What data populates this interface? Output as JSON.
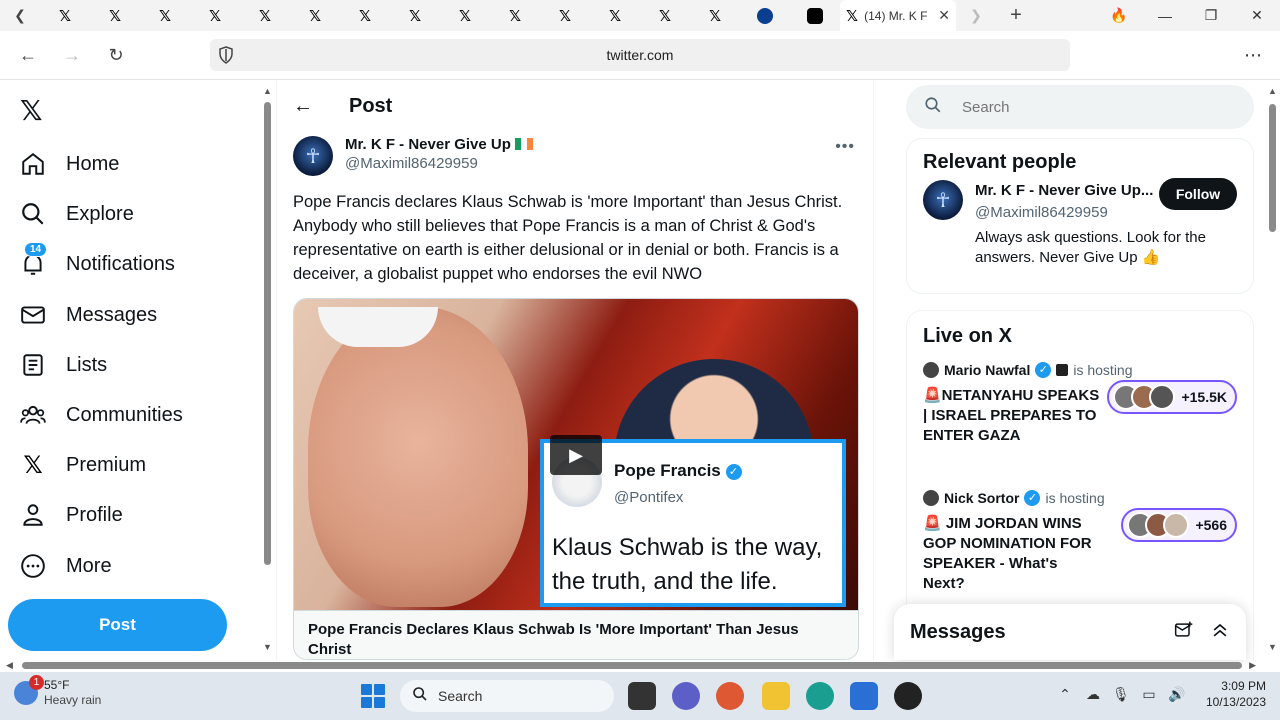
{
  "browser": {
    "active_tab_title": "(14) Mr. K F",
    "url": "twitter.com"
  },
  "nav": {
    "items": [
      {
        "label": "Home",
        "icon": "home-icon"
      },
      {
        "label": "Explore",
        "icon": "search-icon"
      },
      {
        "label": "Notifications",
        "icon": "bell-icon",
        "badge": "14"
      },
      {
        "label": "Messages",
        "icon": "envelope-icon"
      },
      {
        "label": "Lists",
        "icon": "list-icon"
      },
      {
        "label": "Communities",
        "icon": "people-icon"
      },
      {
        "label": "Premium",
        "icon": "x-logo-icon"
      },
      {
        "label": "Profile",
        "icon": "person-icon"
      },
      {
        "label": "More",
        "icon": "more-circle-icon"
      }
    ],
    "post_button": "Post"
  },
  "main": {
    "header_title": "Post",
    "author": {
      "name": "Mr. K F - Never Give Up",
      "handle": "@Maximil86429959"
    },
    "text": "Pope Francis declares Klaus Schwab is 'more Important' than Jesus Christ. Anybody who still believes that Pope Francis is a man of Christ & God's representative on earth is either delusional or in denial or both. Francis is a deceiver, a globalist puppet who endorses the evil NWO",
    "media": {
      "quote_name": "Pope Francis",
      "quote_handle": "@Pontifex",
      "quote_text": "Klaus Schwab is the way, the truth, and the life.",
      "caption": "Pope Francis Declares Klaus Schwab Is 'More Important' Than Jesus Christ"
    }
  },
  "right": {
    "search_placeholder": "Search",
    "relevant": {
      "title": "Relevant people",
      "name": "Mr. K F - Never Give Up...",
      "handle": "@Maximil86429959",
      "bio": "Always ask questions. Look for the answers. Never Give Up 👍",
      "follow_label": "Follow"
    },
    "live": {
      "title": "Live on X",
      "items": [
        {
          "host": "Mario Nawfal",
          "status": "is hosting",
          "title": "🚨NETANYAHU SPEAKS | ISRAEL PREPARES TO ENTER GAZA",
          "listeners": "+15.5K"
        },
        {
          "host": "Nick Sortor",
          "status": "is hosting",
          "title": "🚨 JIM JORDAN WINS GOP NOMINATION FOR SPEAKER - What's Next?",
          "listeners": "+566"
        }
      ]
    },
    "messages_title": "Messages"
  },
  "taskbar": {
    "weather_badge": "1",
    "temp": "55°F",
    "condition": "Heavy rain",
    "search_label": "Search",
    "time": "3:09 PM",
    "date": "10/13/2023"
  }
}
